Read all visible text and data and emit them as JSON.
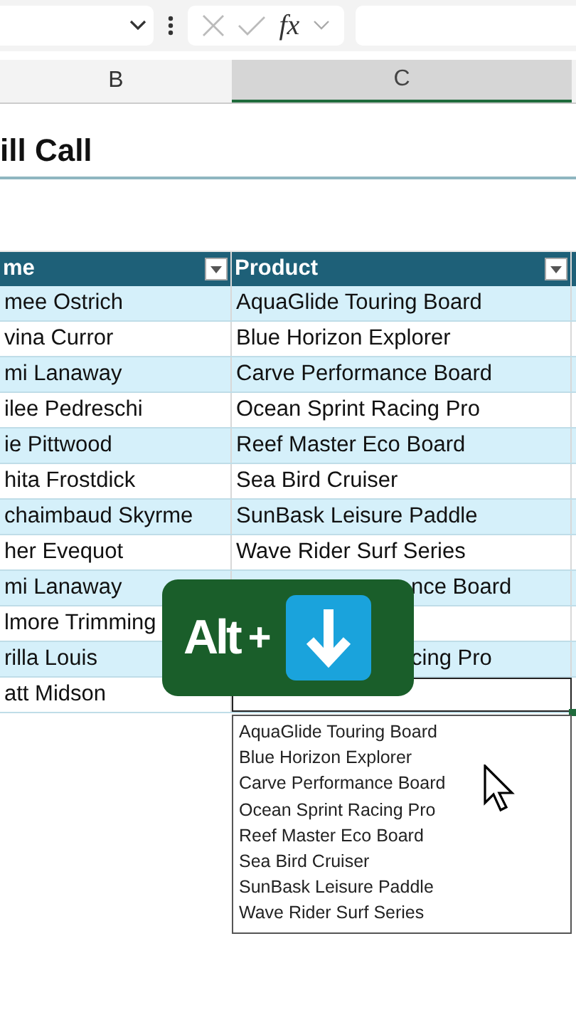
{
  "formula_bar": {
    "function_label": "fx"
  },
  "column_headers": [
    {
      "label": "B",
      "selected": false
    },
    {
      "label": "C",
      "selected": true
    }
  ],
  "title": "ill Call",
  "table": {
    "columns": [
      "me",
      "Product"
    ],
    "rows": [
      {
        "name": "mee Ostrich",
        "product": "AquaGlide Touring Board",
        "kind": "plain",
        "selected": false
      },
      {
        "name": "vina Curror",
        "product": "Blue Horizon Explorer",
        "kind": "plain",
        "selected": false
      },
      {
        "name": "mi Lanaway",
        "product": "Carve Performance Board",
        "kind": "plain",
        "selected": false
      },
      {
        "name": "ilee Pedreschi",
        "product": "Ocean Sprint Racing Pro",
        "kind": "plain",
        "selected": false
      },
      {
        "name": "ie Pittwood",
        "product": "Reef Master Eco Board",
        "kind": "plain",
        "selected": false
      },
      {
        "name": "hita Frostdick",
        "product": "Sea Bird Cruiser",
        "kind": "plain",
        "selected": false
      },
      {
        "name": "chaimbaud Skyrme",
        "product": "SunBask Leisure Paddle",
        "kind": "plain",
        "selected": false
      },
      {
        "name": "her Evequot",
        "product": "Wave Rider Surf Series",
        "kind": "plain",
        "selected": false
      },
      {
        "name": "mi Lanaway",
        "product": "nce Board",
        "kind": "covered",
        "selected": false
      },
      {
        "name": "lmore Trimming",
        "kind": "covered",
        "selected": false
      },
      {
        "name": "rilla Louis",
        "product": "cing Pro",
        "kind": "covered",
        "selected": false
      },
      {
        "name": "att Midson",
        "kind": "plain",
        "selected": true
      }
    ]
  },
  "dropdown": {
    "items": [
      "AquaGlide Touring Board",
      "Blue Horizon Explorer",
      "Carve Performance Board",
      "Ocean Sprint Racing Pro",
      "Reef Master Eco Board",
      "Sea Bird Cruiser",
      "SunBask Leisure Paddle",
      "Wave Rider Surf Series"
    ]
  },
  "key_hint": {
    "key": "Alt",
    "plus": "+"
  }
}
